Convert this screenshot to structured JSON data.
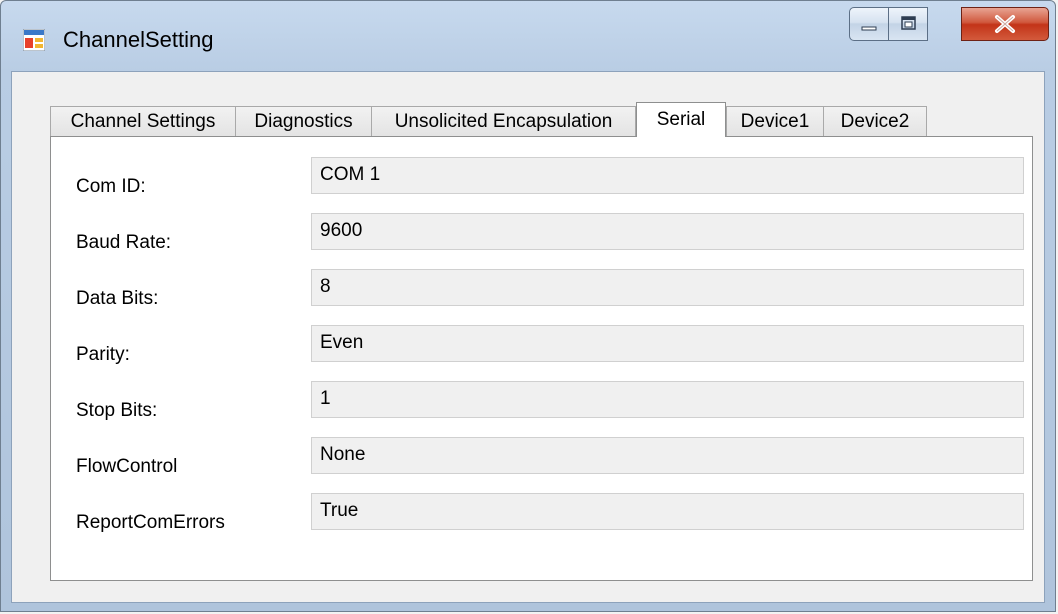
{
  "window": {
    "title": "ChannelSetting",
    "icon": "form-window-icon"
  },
  "title_buttons": [
    {
      "name": "minimize-icon"
    },
    {
      "name": "maximize-icon"
    },
    {
      "name": "close-icon",
      "label": "X"
    }
  ],
  "tabs": [
    {
      "label": "Channel Settings",
      "active": false
    },
    {
      "label": "Diagnostics",
      "active": false
    },
    {
      "label": "Unsolicited Encapsulation",
      "active": false
    },
    {
      "label": "Serial",
      "active": true
    },
    {
      "label": "Device1",
      "active": false
    },
    {
      "label": "Device2",
      "active": false
    }
  ],
  "serial": {
    "fields": [
      {
        "label": "Com ID:",
        "value": "COM 1"
      },
      {
        "label": "Baud Rate:",
        "value": "9600"
      },
      {
        "label": "Data Bits:",
        "value": "8"
      },
      {
        "label": "Parity:",
        "value": "Even"
      },
      {
        "label": "Stop Bits:",
        "value": "1"
      },
      {
        "label": "FlowControl",
        "value": "None"
      },
      {
        "label": "ReportComErrors",
        "value": "True"
      }
    ]
  },
  "colors": {
    "titlebar": "#c7d9ee",
    "close_button": "#c33418",
    "panel_background": "#ffffff",
    "field_background": "#f0f0f0"
  }
}
